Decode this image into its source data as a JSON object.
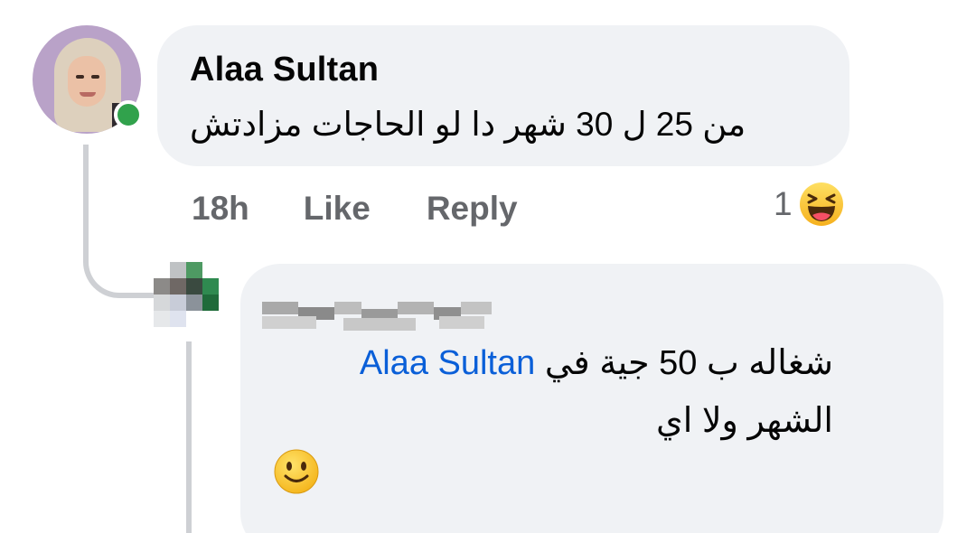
{
  "comment": {
    "author": "Alaa Sultan",
    "text": "من 25 ل 30 شهر دا لو الحاجات مزادتش",
    "time": "18h",
    "like_label": "Like",
    "reply_label": "Reply",
    "reaction_count": "1",
    "reaction_icon": "haha-emoji-icon",
    "online_status_color": "#31a24c"
  },
  "reply": {
    "author_blurred": true,
    "text_before_mention": "شغاله ب 50 جية في",
    "mention": "Alaa Sultan",
    "text_after_mention": "الشهر ولا اي",
    "emoji_icon": "slightly-smiling-face-icon"
  },
  "colors": {
    "bubble_bg": "#f0f2f5",
    "secondary_text": "#65676b",
    "mention": "#0a5fd8",
    "thread_line": "#ced0d4"
  }
}
